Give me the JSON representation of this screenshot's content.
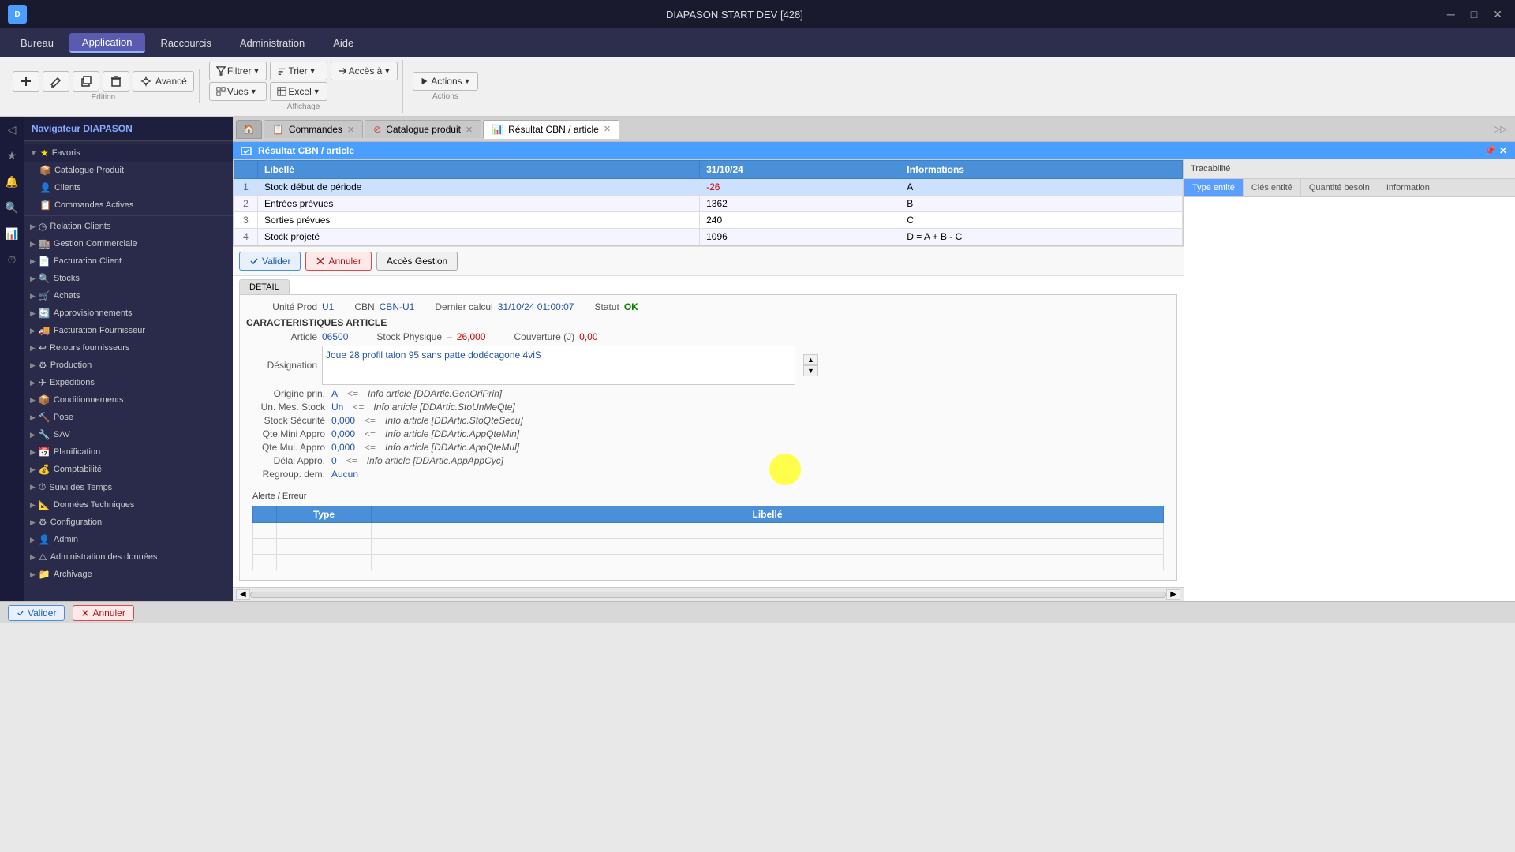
{
  "app": {
    "title": "DIAPASON START DEV [428]",
    "logo": "D"
  },
  "menubar": {
    "items": [
      "Bureau",
      "Application",
      "Raccourcis",
      "Administration",
      "Aide"
    ],
    "active": "Application"
  },
  "toolbar": {
    "groups": [
      {
        "label": "Edition",
        "buttons": [
          {
            "id": "add",
            "icon": "+",
            "label": ""
          },
          {
            "id": "edit",
            "icon": "✎",
            "label": ""
          },
          {
            "id": "copy",
            "icon": "⧉",
            "label": ""
          },
          {
            "id": "delete",
            "icon": "🗑",
            "label": ""
          },
          {
            "id": "settings",
            "icon": "⚙",
            "label": "Avancé"
          }
        ]
      },
      {
        "label": "Affichage",
        "buttons": [
          {
            "id": "filter",
            "icon": "▼",
            "label": "Filtrer"
          },
          {
            "id": "sort",
            "icon": "↕",
            "label": "Trier"
          },
          {
            "id": "access",
            "icon": "→",
            "label": "Accès à"
          },
          {
            "id": "views",
            "icon": "◧",
            "label": "Vues"
          },
          {
            "id": "excel",
            "icon": "▦",
            "label": "Excel"
          }
        ]
      },
      {
        "label": "Actions",
        "buttons": [
          {
            "id": "actions",
            "icon": "▶",
            "label": "Actions"
          }
        ]
      }
    ]
  },
  "sidebar": {
    "title": "Navigateur DIAPASON",
    "sections": [
      {
        "indent": 0,
        "icon": "★",
        "label": "Favoris",
        "arrow": "▼",
        "type": "folder"
      },
      {
        "indent": 1,
        "icon": "📦",
        "label": "Catalogue Produit",
        "arrow": "",
        "type": "item"
      },
      {
        "indent": 1,
        "icon": "👤",
        "label": "Clients",
        "arrow": "",
        "type": "item"
      },
      {
        "indent": 1,
        "icon": "📋",
        "label": "Commandes Actives",
        "arrow": "",
        "type": "item"
      },
      {
        "indent": 0,
        "icon": "◷",
        "label": "Relation Clients",
        "arrow": "▶",
        "type": "folder"
      },
      {
        "indent": 0,
        "icon": "🏬",
        "label": "Gestion Commerciale",
        "arrow": "▶",
        "type": "folder"
      },
      {
        "indent": 0,
        "icon": "📄",
        "label": "Facturation Client",
        "arrow": "▶",
        "type": "folder"
      },
      {
        "indent": 0,
        "icon": "🔍",
        "label": "Stocks",
        "arrow": "▶",
        "type": "folder"
      },
      {
        "indent": 0,
        "icon": "🛒",
        "label": "Achats",
        "arrow": "▶",
        "type": "folder"
      },
      {
        "indent": 0,
        "icon": "🔄",
        "label": "Approvisionnements",
        "arrow": "▶",
        "type": "folder"
      },
      {
        "indent": 0,
        "icon": "🚚",
        "label": "Facturation Fournisseur",
        "arrow": "▶",
        "type": "folder"
      },
      {
        "indent": 0,
        "icon": "↩",
        "label": "Retours fournisseurs",
        "arrow": "▶",
        "type": "folder"
      },
      {
        "indent": 0,
        "icon": "⚙",
        "label": "Production",
        "arrow": "▶",
        "type": "folder"
      },
      {
        "indent": 0,
        "icon": "✈",
        "label": "Expéditions",
        "arrow": "▶",
        "type": "folder"
      },
      {
        "indent": 0,
        "icon": "📦",
        "label": "Conditionnements",
        "arrow": "▶",
        "type": "folder"
      },
      {
        "indent": 0,
        "icon": "🔨",
        "label": "Pose",
        "arrow": "▶",
        "type": "folder"
      },
      {
        "indent": 0,
        "icon": "🔧",
        "label": "SAV",
        "arrow": "▶",
        "type": "folder"
      },
      {
        "indent": 0,
        "icon": "📅",
        "label": "Planification",
        "arrow": "▶",
        "type": "folder"
      },
      {
        "indent": 0,
        "icon": "💰",
        "label": "Comptabilité",
        "arrow": "▶",
        "type": "folder"
      },
      {
        "indent": 0,
        "icon": "⏱",
        "label": "Suivi des Temps",
        "arrow": "▶",
        "type": "folder"
      },
      {
        "indent": 0,
        "icon": "📐",
        "label": "Données Techniques",
        "arrow": "▶",
        "type": "folder"
      },
      {
        "indent": 0,
        "icon": "⚙",
        "label": "Configuration",
        "arrow": "▶",
        "type": "folder"
      },
      {
        "indent": 0,
        "icon": "👤",
        "label": "Admin",
        "arrow": "▶",
        "type": "folder"
      },
      {
        "indent": 0,
        "icon": "⚠",
        "label": "Administration des données",
        "arrow": "▶",
        "type": "folder"
      },
      {
        "indent": 0,
        "icon": "📁",
        "label": "Archivage",
        "arrow": "▶",
        "type": "folder"
      }
    ]
  },
  "tabs": [
    {
      "id": "home",
      "type": "home",
      "icon": "🏠",
      "label": ""
    },
    {
      "id": "commandes",
      "label": "Commandes",
      "icon": "📋",
      "active": false,
      "closable": true
    },
    {
      "id": "catalogue",
      "label": "Catalogue produit",
      "icon": "⊘",
      "active": false,
      "closable": true
    },
    {
      "id": "resultat",
      "label": "Résultat CBN / article",
      "icon": "📊",
      "active": true,
      "closable": true
    }
  ],
  "panel": {
    "title": "Résultat CBN / article",
    "table": {
      "columns": [
        "Libellé",
        "31/10/24",
        "Informations"
      ],
      "rows": [
        {
          "num": 1,
          "libelle": "Stock début de période",
          "value": "-26",
          "info": "A",
          "selected": true
        },
        {
          "num": 2,
          "libelle": "Entrées prévues",
          "value": "1362",
          "info": "B",
          "selected": false
        },
        {
          "num": 3,
          "libelle": "Sorties prévues",
          "value": "240",
          "info": "C",
          "selected": false
        },
        {
          "num": 4,
          "libelle": "Stock projeté",
          "value": "1096",
          "info": "D = A + B - C",
          "selected": false
        }
      ]
    },
    "buttons": {
      "valider": "Valider",
      "annuler": "Annuler",
      "acces_gestion": "Accès Gestion"
    }
  },
  "detail": {
    "tab_label": "DETAIL",
    "unite_prod_label": "Unité Prod",
    "unite_prod_value": "U1",
    "cbn_label": "CBN",
    "cbn_value": "CBN-U1",
    "dernier_calcul_label": "Dernier calcul",
    "dernier_calcul_value": "31/10/24 01:00:07",
    "statut_label": "Statut",
    "statut_value": "OK",
    "char_title": "CARACTERISTIQUES ARTICLE",
    "article_label": "Article",
    "article_value": "06500",
    "stock_physique_label": "Stock Physique",
    "stock_physique_dash": "–",
    "stock_physique_value": "26,000",
    "couverture_label": "Couverture (J)",
    "couverture_value": "0,00",
    "designation_label": "Désignation",
    "designation_value": "Joue 28 profil talon 95 sans patte dodécagone 4viS",
    "fields": [
      {
        "label": "Origine prin.",
        "value": "A",
        "arrow": "<=",
        "info": "Info article [DDArtic.GenOriPrin]"
      },
      {
        "label": "Un. Mes. Stock",
        "value": "Un",
        "arrow": "<=",
        "info": "Info article [DDArtic.StoUnMeQte]"
      },
      {
        "label": "Stock Sécurité",
        "value": "0,000",
        "arrow": "<=",
        "info": "Info article [DDArtic.StoQteSecu]"
      },
      {
        "label": "Qte Mini Appro",
        "value": "0,000",
        "arrow": "<=",
        "info": "Info article [DDArtic.AppQteMin]"
      },
      {
        "label": "Qte Mul. Appro",
        "value": "0,000",
        "arrow": "<=",
        "info": "Info article [DDArtic.AppQteMul]"
      },
      {
        "label": "Délai Appro.",
        "value": "0",
        "arrow": "<=",
        "info": "Info article [DDArtic.AppAppCyc]"
      },
      {
        "label": "Regroup. dem.",
        "value": "Aucun",
        "arrow": "",
        "info": ""
      }
    ]
  },
  "alert": {
    "title": "Alerte / Erreur",
    "columns": [
      "Type",
      "Libellé"
    ]
  },
  "tracabilite": {
    "label": "Tracabilité",
    "tabs": [
      "Type entité",
      "Clés entité",
      "Quantité besoin",
      "Information"
    ]
  },
  "statusbar": {
    "valider": "Valider",
    "annuler": "Annuler"
  }
}
